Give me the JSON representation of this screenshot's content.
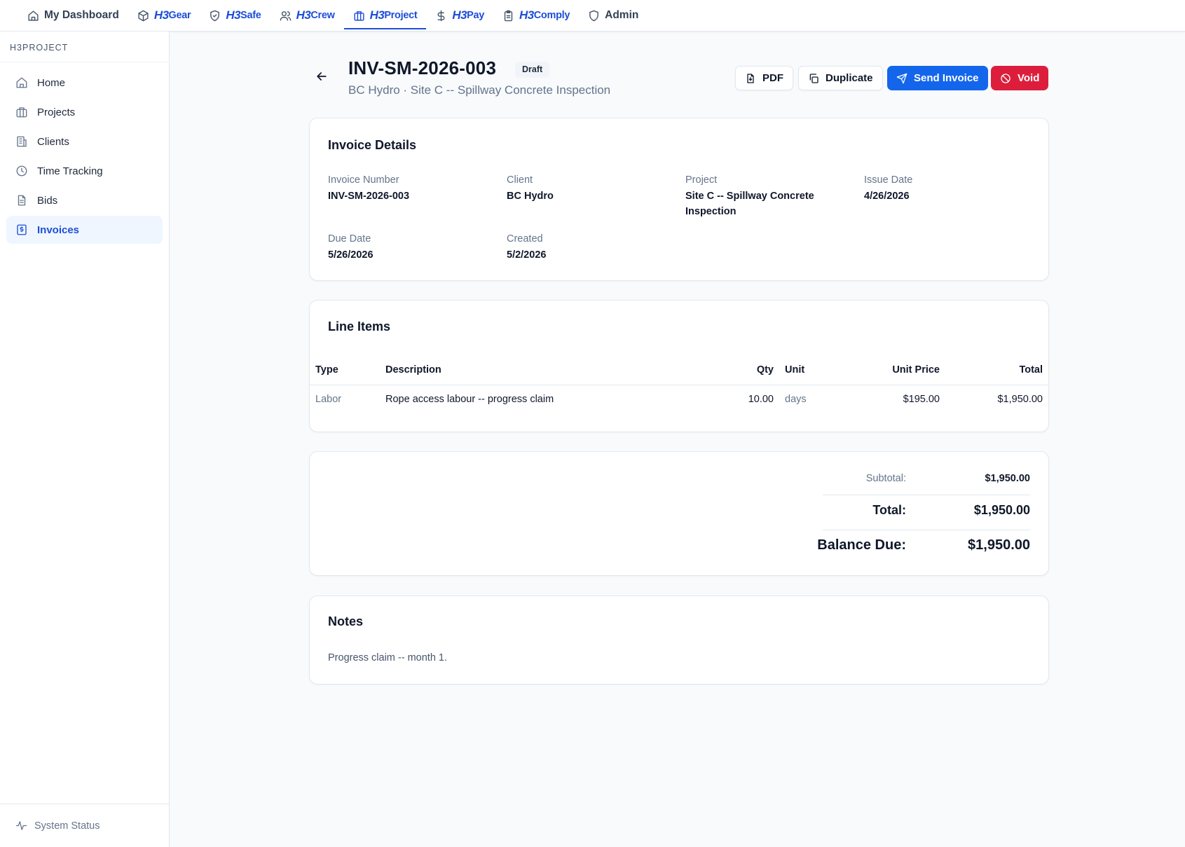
{
  "topnav": {
    "items": [
      {
        "label": "My Dashboard",
        "icon": "home-icon"
      },
      {
        "brand": "H3",
        "suffix": "Gear",
        "icon": "box-icon"
      },
      {
        "brand": "H3",
        "suffix": "Safe",
        "icon": "shield-check-icon"
      },
      {
        "brand": "H3",
        "suffix": "Crew",
        "icon": "users-icon"
      },
      {
        "brand": "H3",
        "suffix": "Project",
        "icon": "briefcase-icon",
        "active": true
      },
      {
        "brand": "H3",
        "suffix": "Pay",
        "icon": "dollar-icon"
      },
      {
        "brand": "H3",
        "suffix": "Comply",
        "icon": "clipboard-icon"
      },
      {
        "label": "Admin",
        "icon": "shield-icon"
      }
    ]
  },
  "sidebar": {
    "heading": "H3PROJECT",
    "items": [
      {
        "label": "Home",
        "icon": "home-icon"
      },
      {
        "label": "Projects",
        "icon": "briefcase-icon"
      },
      {
        "label": "Clients",
        "icon": "building-icon"
      },
      {
        "label": "Time Tracking",
        "icon": "clock-icon"
      },
      {
        "label": "Bids",
        "icon": "file-icon"
      },
      {
        "label": "Invoices",
        "icon": "invoice-icon",
        "active": true
      }
    ],
    "footer": "System Status"
  },
  "header": {
    "title": "INV-SM-2026-003",
    "status": "Draft",
    "subtitle": "BC Hydro · Site C -- Spillway Concrete Inspection",
    "buttons": {
      "pdf": "PDF",
      "duplicate": "Duplicate",
      "send": "Send Invoice",
      "void": "Void"
    }
  },
  "details": {
    "title": "Invoice Details",
    "invoice_number": {
      "label": "Invoice Number",
      "value": "INV-SM-2026-003"
    },
    "client": {
      "label": "Client",
      "value": "BC Hydro"
    },
    "project": {
      "label": "Project",
      "value": "Site C -- Spillway Concrete Inspection"
    },
    "issue_date": {
      "label": "Issue Date",
      "value": "4/26/2026"
    },
    "due_date": {
      "label": "Due Date",
      "value": "5/26/2026"
    },
    "created": {
      "label": "Created",
      "value": "5/2/2026"
    }
  },
  "line_items": {
    "title": "Line Items",
    "columns": {
      "type": "Type",
      "description": "Description",
      "qty": "Qty",
      "unit": "Unit",
      "unit_price": "Unit Price",
      "total": "Total"
    },
    "rows": [
      {
        "type": "Labor",
        "description": "Rope access labour -- progress claim",
        "qty": "10.00",
        "unit": "days",
        "unit_price": "$195.00",
        "total": "$1,950.00"
      }
    ]
  },
  "totals": {
    "subtotal_label": "Subtotal:",
    "subtotal": "$1,950.00",
    "total_label": "Total:",
    "total": "$1,950.00",
    "balance_label": "Balance Due:",
    "balance": "$1,950.00"
  },
  "notes": {
    "title": "Notes",
    "text": "Progress claim -- month 1."
  },
  "colors": {
    "accent": "#1366ec",
    "danger": "#dc1e3c",
    "active_nav": "#1d4ed8"
  }
}
